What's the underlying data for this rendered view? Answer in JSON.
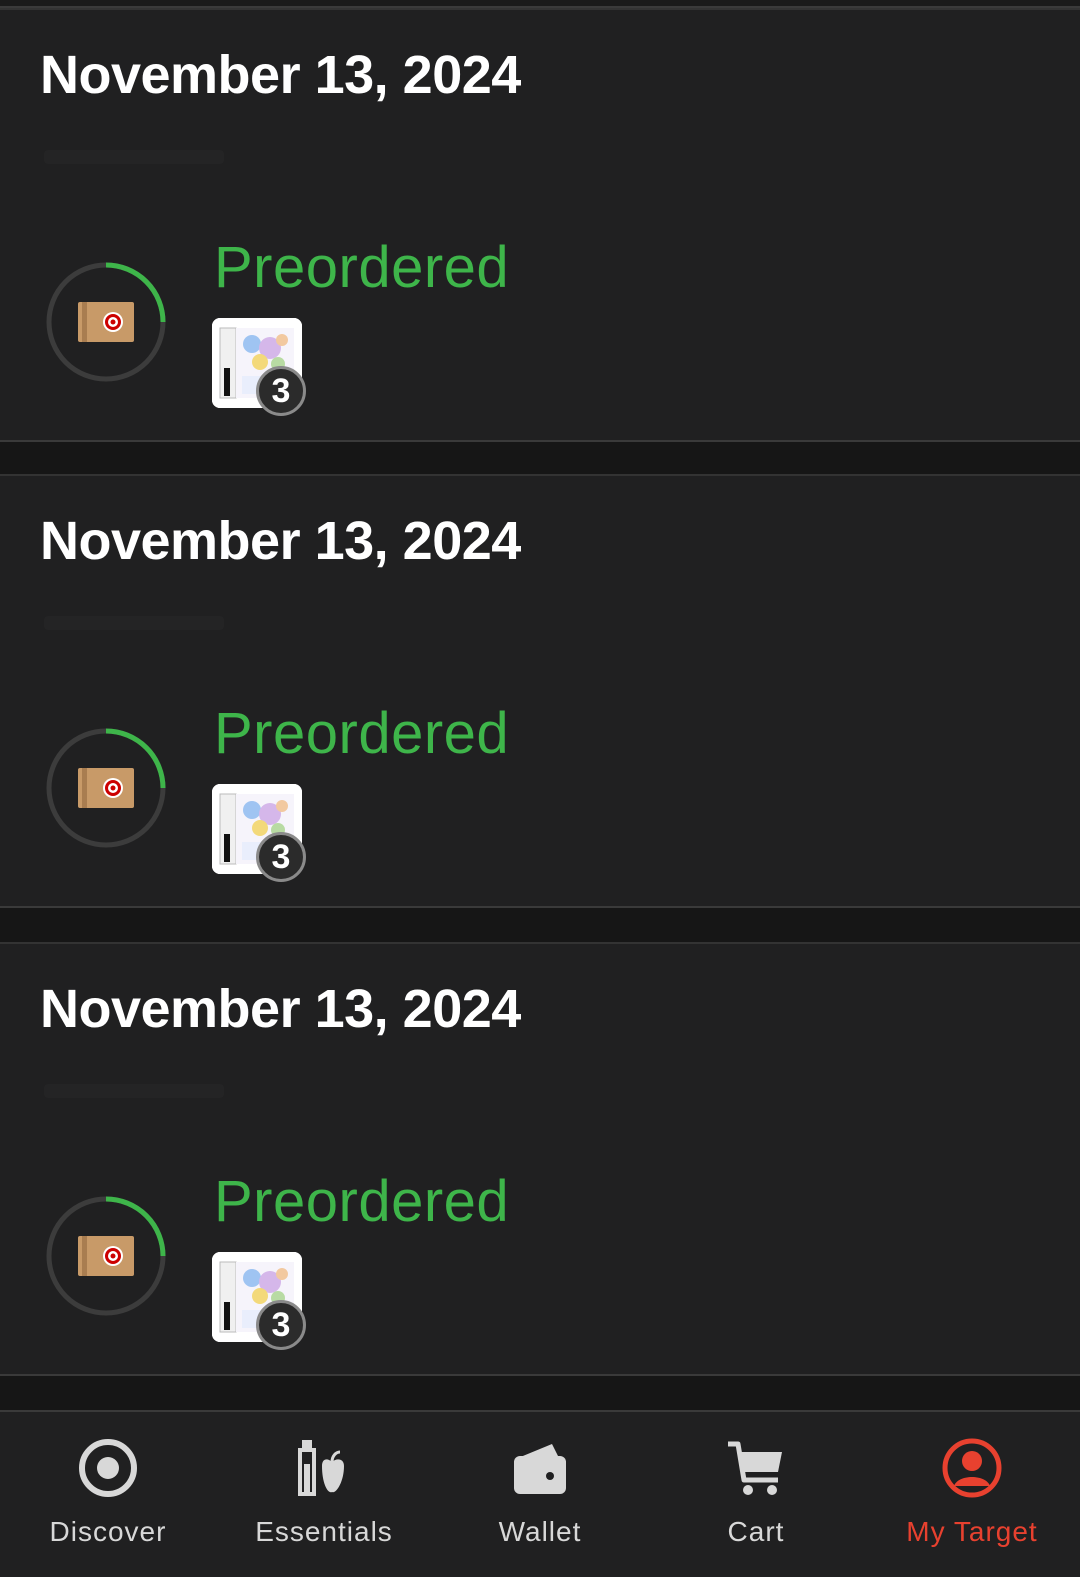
{
  "orders": [
    {
      "date": "November 13, 2024",
      "status": "Preordered",
      "quantity": "3"
    },
    {
      "date": "November 13, 2024",
      "status": "Preordered",
      "quantity": "3"
    },
    {
      "date": "November 13, 2024",
      "status": "Preordered",
      "quantity": "3"
    }
  ],
  "nav": {
    "items": [
      {
        "label": "Discover",
        "icon": "bullseye-icon"
      },
      {
        "label": "Essentials",
        "icon": "bottle-apple-icon"
      },
      {
        "label": "Wallet",
        "icon": "wallet-icon"
      },
      {
        "label": "Cart",
        "icon": "cart-icon"
      },
      {
        "label": "My Target",
        "icon": "profile-icon",
        "active": true
      }
    ]
  },
  "colors": {
    "status_green": "#3eb54a",
    "accent_red": "#e8412f",
    "background": "#202021"
  }
}
